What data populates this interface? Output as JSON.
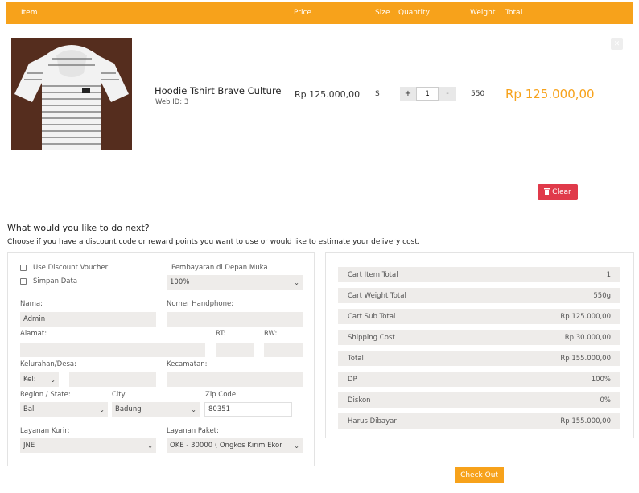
{
  "cart": {
    "headers": {
      "item": "Item",
      "price": "Price",
      "size": "Size",
      "quantity": "Quantity",
      "weight": "Weight",
      "total": "Total"
    },
    "item": {
      "name": "Hoodie Tshirt Brave Culture",
      "web_id": "Web ID: 3",
      "price": "Rp 125.000,00",
      "size": "S",
      "quantity": "1",
      "qty_plus": "+",
      "qty_minus": "-",
      "weight": "550",
      "total": "Rp 125.000,00"
    },
    "clear_label": "Clear"
  },
  "next": {
    "title": "What would you like to do next?",
    "subtitle": "Choose if you have a discount code or reward points you want to use or would like to estimate your delivery cost."
  },
  "form": {
    "use_voucher": "Use Discount Voucher",
    "save_data": "Simpan Data",
    "dp_label": "Pembayaran di Depan Muka",
    "dp_value": "100%",
    "name_label": "Nama:",
    "name_value": "Admin",
    "phone_label": "Nomer Handphone:",
    "address_label": "Alamat:",
    "rt_label": "RT:",
    "rw_label": "RW:",
    "kelurahan_label": "Kelurahan/Desa:",
    "kelurahan_select": "Kel:",
    "kecamatan_label": "Kecamatan:",
    "region_label": "Region / State:",
    "region_value": "Bali",
    "city_label": "City:",
    "city_value": "Badung",
    "zip_label": "Zip Code:",
    "zip_value": "80351",
    "courier_label": "Layanan Kurir:",
    "courier_value": "JNE",
    "package_label": "Layanan Paket:",
    "package_value": "OKE - 30000 ( Ongkos Kirim Ekor"
  },
  "summary": [
    {
      "key": "Cart Item Total",
      "value": "1"
    },
    {
      "key": "Cart Weight Total",
      "value": "550g"
    },
    {
      "key": "Cart Sub Total",
      "value": "Rp 125.000,00"
    },
    {
      "key": "Shipping Cost",
      "value": "Rp 30.000,00"
    },
    {
      "key": "Total",
      "value": "Rp 155.000,00"
    },
    {
      "key": "DP",
      "value": "100%"
    },
    {
      "key": "Diskon",
      "value": "0%"
    },
    {
      "key": "Harus Dibayar",
      "value": "Rp 155.000,00"
    }
  ],
  "checkout_label": "Check Out",
  "icons": {
    "remove": "close-icon",
    "clear": "trash-icon",
    "select": "chevron-down-icon"
  },
  "colors": {
    "accent": "#f7a21b",
    "danger": "#e03a4a",
    "field_bg": "#eeecea"
  }
}
